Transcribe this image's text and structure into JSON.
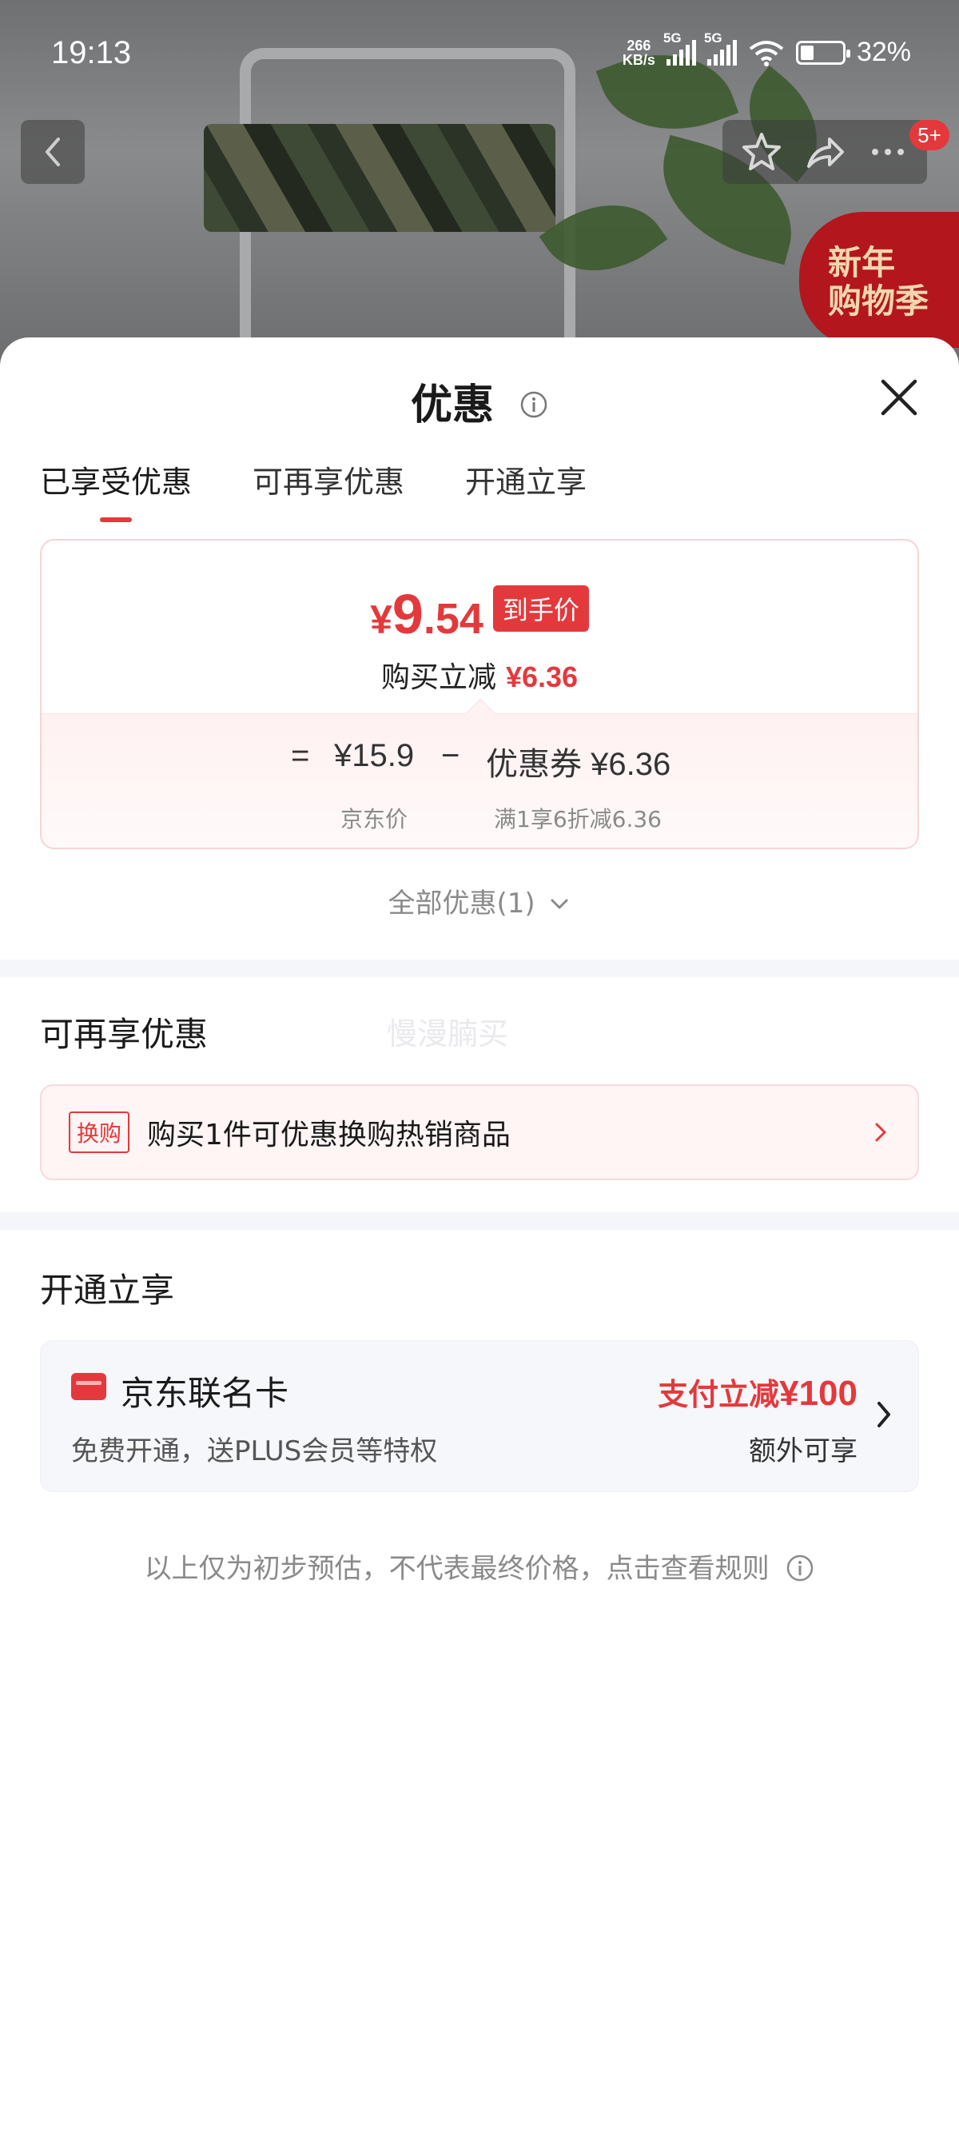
{
  "status": {
    "time": "19:13",
    "net_speed_top": "266",
    "net_speed_unit": "KB/s",
    "sim1": "5G",
    "sim2": "5G",
    "battery": "32%"
  },
  "nav": {
    "badge": "5+",
    "promo_line1": "新年",
    "promo_line2": "购物季"
  },
  "sheet": {
    "title": "优惠",
    "tabs": [
      {
        "label": "已享受优惠",
        "active": true
      },
      {
        "label": "可再享优惠",
        "active": false
      },
      {
        "label": "开通立享",
        "active": false
      }
    ]
  },
  "enjoyed": {
    "currency": "¥",
    "price_int": "9",
    "price_dec": ".54",
    "price_tag": "到手价",
    "reduce_label": "购买立减",
    "reduce_amount": "¥6.36",
    "eq": "=",
    "jd_price": "¥15.9",
    "minus": "−",
    "coupon": "优惠券 ¥6.36",
    "jd_price_label": "京东价",
    "coupon_desc": "满1享6折减6.36"
  },
  "all_offers": "全部优惠(1)",
  "more_offers": {
    "title": "可再享优惠",
    "watermark": "慢漫腩买",
    "swap_tag": "换购",
    "swap_text": "购买1件可优惠换购热销商品"
  },
  "open_now": {
    "title": "开通立享",
    "card_name": "京东联名卡",
    "card_desc": "免费开通，送PLUS会员等特权",
    "reduce_prefix": "支付立减",
    "reduce_amount": "¥100",
    "extra": "额外可享"
  },
  "disclaimer": "以上仅为初步预估，不代表最终价格，点击查看规则",
  "colors": {
    "accent": "#e4393c",
    "muted": "#8a8a8a",
    "divider": "#f5f6fa"
  }
}
